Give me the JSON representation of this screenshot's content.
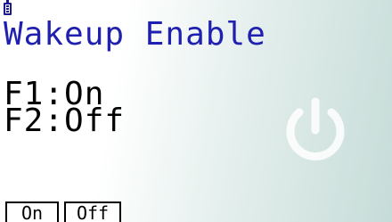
{
  "status_bar": {
    "battery_icon": "battery-icon"
  },
  "screen": {
    "title": "Wakeup Enable",
    "lines": [
      "F1:On",
      "F2:Off"
    ],
    "background_icon": "power-icon"
  },
  "function_keys": [
    {
      "key": "F1",
      "label": "On"
    },
    {
      "key": "F2",
      "label": "Off"
    }
  ],
  "colors": {
    "title": "#1f1fb0",
    "text": "#000000",
    "icon": "#ffffff"
  }
}
